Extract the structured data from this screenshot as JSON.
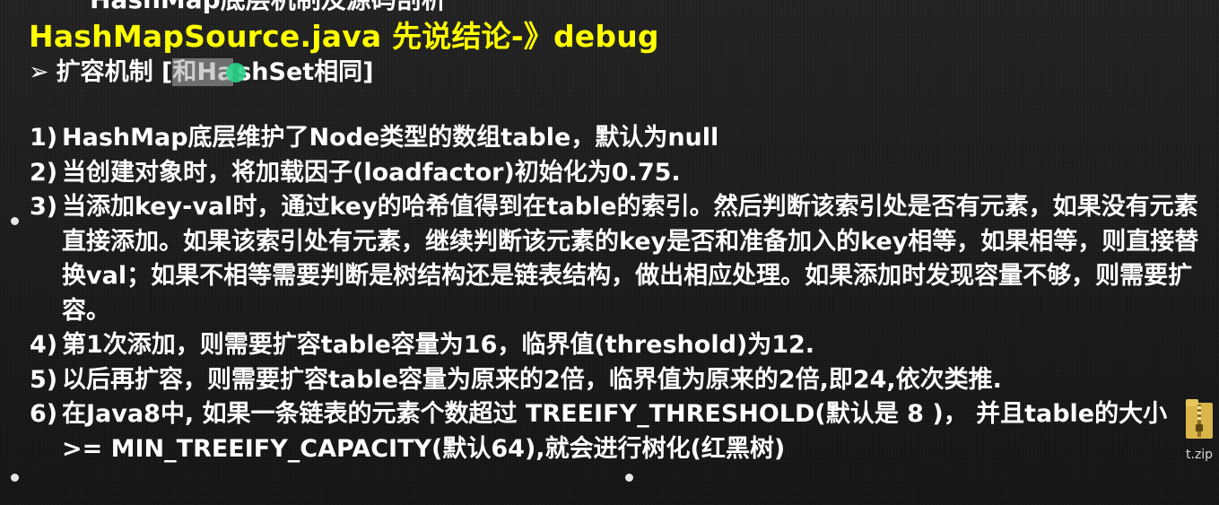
{
  "slide": {
    "top_cut_text": "HashMap底层机制及源码剖析",
    "title": "HashMapSource.java  先说结论-》debug",
    "bullet": {
      "arrow": "➢",
      "prefix": "扩容机制 [",
      "selected": "和Ha",
      "rest": "shSet相同]"
    },
    "items": [
      {
        "num": "1)",
        "text": "HashMap底层维护了Node类型的数组table，默认为null"
      },
      {
        "num": "2)",
        "text": "当创建对象时，将加载因子(loadfactor)初始化为0.75."
      },
      {
        "num": "3)",
        "text": "当添加key-val时，通过key的哈希值得到在table的索引。然后判断该索引处是否有元素，如果没有元素直接添加。如果该索引处有元素，继续判断该元素的key是否和准备加入的key相等，如果相等，则直接替换val；如果不相等需要判断是树结构还是链表结构，做出相应处理。如果添加时发现容量不够，则需要扩容。"
      },
      {
        "num": "4)",
        "text": "第1次添加，则需要扩容table容量为16，临界值(threshold)为12."
      },
      {
        "num": "5)",
        "text": "以后再扩容，则需要扩容table容量为原来的2倍，临界值为原来的2倍,即24,依次类推."
      },
      {
        "num": "6)",
        "text": "在Java8中, 如果一条链表的元素个数超过 TREEIFY_THRESHOLD(默认是 8 )， 并且table的大小 >= MIN_TREEIFY_CAPACITY(默认64),就会进行树化(红黑树)"
      }
    ]
  },
  "desktop": {
    "zip_label": "t.zip"
  },
  "colors": {
    "title": "#ffff00",
    "text": "#ffffff",
    "selection": "#6f6f6f",
    "cursor": "#2bd48a"
  }
}
